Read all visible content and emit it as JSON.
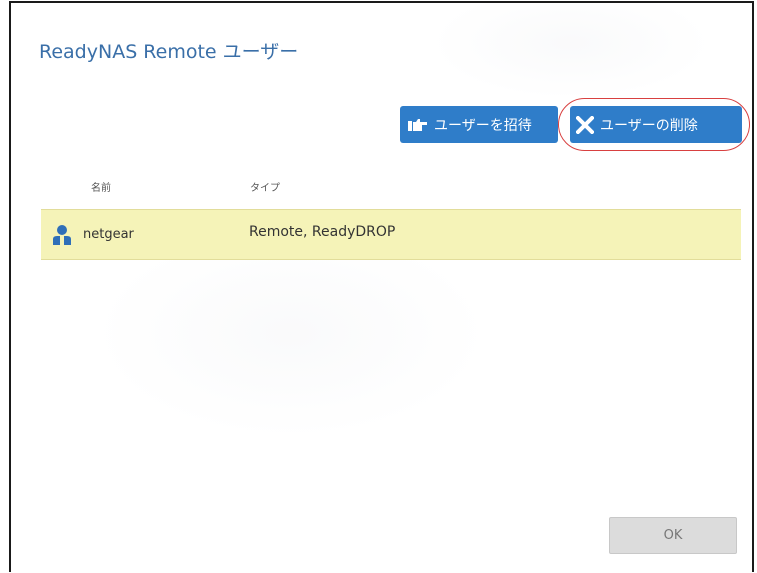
{
  "dialog": {
    "title": "ReadyNAS Remote ユーザー"
  },
  "toolbar": {
    "invite_label": "ユーザーを招待",
    "invite_icon": "hand-pointing-icon",
    "delete_label": "ユーザーの削除",
    "delete_icon": "x-icon",
    "button_color": "#2f7dc9",
    "highlight_color": "#d84040"
  },
  "table": {
    "columns": [
      "名前",
      "タイプ"
    ],
    "rows": [
      {
        "icon": "user-icon",
        "name": "netgear",
        "type": "Remote, ReadyDROP"
      }
    ],
    "selected_row_color": "#f5f3b8"
  },
  "footer": {
    "ok_label": "OK"
  }
}
